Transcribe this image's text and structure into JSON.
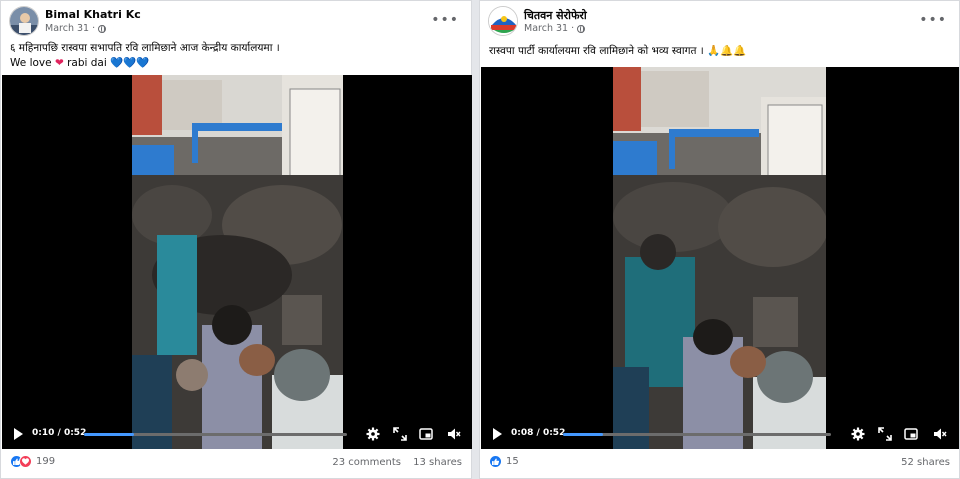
{
  "posts": [
    {
      "author": "Bimal Khatri Kc",
      "date": "March 31",
      "caption_line1": "६ महिनापछि रास्वपा सभापति रवि लामिछाने आज केन्द्रीय कार्यालयमा ।",
      "caption_line2_pre": "We love",
      "caption_line2_mid": "rabi dai",
      "time": "0:10 / 0:52",
      "progress": 0.19,
      "reaction_count": "199",
      "comments": "23 comments",
      "shares": "13 shares"
    },
    {
      "author": "चितवन सेरोफेरो",
      "date": "March 31",
      "caption_line1": "रास्वपा पार्टी कार्यालयमा रवि लामिछाने को भव्य स्वागत ।",
      "time": "0:08 / 0:52",
      "progress": 0.15,
      "reaction_count": "15",
      "shares": "52 shares"
    }
  ],
  "colors": {
    "accent": "#4599ff",
    "like": "#1877f2",
    "love": "#f33e58",
    "crowd_wall": "#2e7bcf"
  },
  "icons": [
    "more-options-icon",
    "globe-icon",
    "play-icon",
    "settings-icon",
    "fullscreen-icon",
    "pip-icon",
    "volume-muted-icon",
    "like-icon",
    "love-icon",
    "heart-emoji-icon",
    "blue-heart-emoji-icon",
    "folded-hands-emoji-icon",
    "bell-emoji-icon"
  ]
}
